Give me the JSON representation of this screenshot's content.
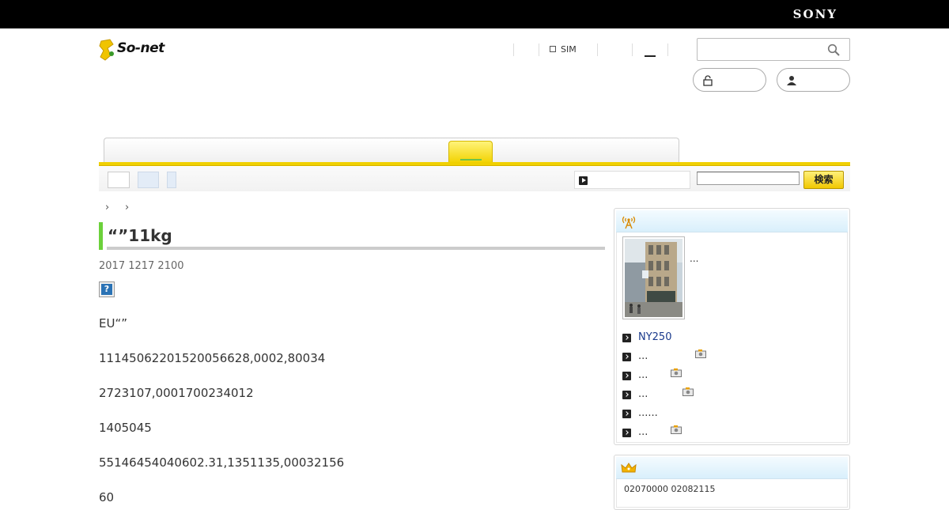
{
  "brand": {
    "sony": "SONY",
    "sonet": "So-net"
  },
  "header": {
    "nav_sim": "SIM",
    "search_placeholder": ""
  },
  "subnav": {
    "search_button": "検索"
  },
  "breadcrumb": {
    "sep1": "›",
    "sep2": "›"
  },
  "article": {
    "title": "“”11kg",
    "date": "2017 1217 2100",
    "help_glyph": "?",
    "paragraphs": [
      "EU“”",
      "11145062201520056628,0002,80034",
      "2723107,0001700234012",
      "1405045",
      "55146454040602.31,1351135,00032156",
      "60"
    ]
  },
  "sidebar": {
    "news": {
      "thumb_caption": "...",
      "items": [
        {
          "text": "NY250",
          "link": true,
          "camera": false
        },
        {
          "text": "...",
          "link": false,
          "camera": true
        },
        {
          "text": "...",
          "link": false,
          "camera": true
        },
        {
          "text": "...",
          "link": false,
          "camera": true
        },
        {
          "text": "......",
          "link": false,
          "camera": false
        },
        {
          "text": "...",
          "link": false,
          "camera": true
        }
      ]
    },
    "ranking": {
      "text": "02070000  02082115"
    }
  },
  "colors": {
    "accent_yellow": "#f0d000",
    "title_green": "#6cd13b",
    "link_blue": "#1a3a8c"
  }
}
